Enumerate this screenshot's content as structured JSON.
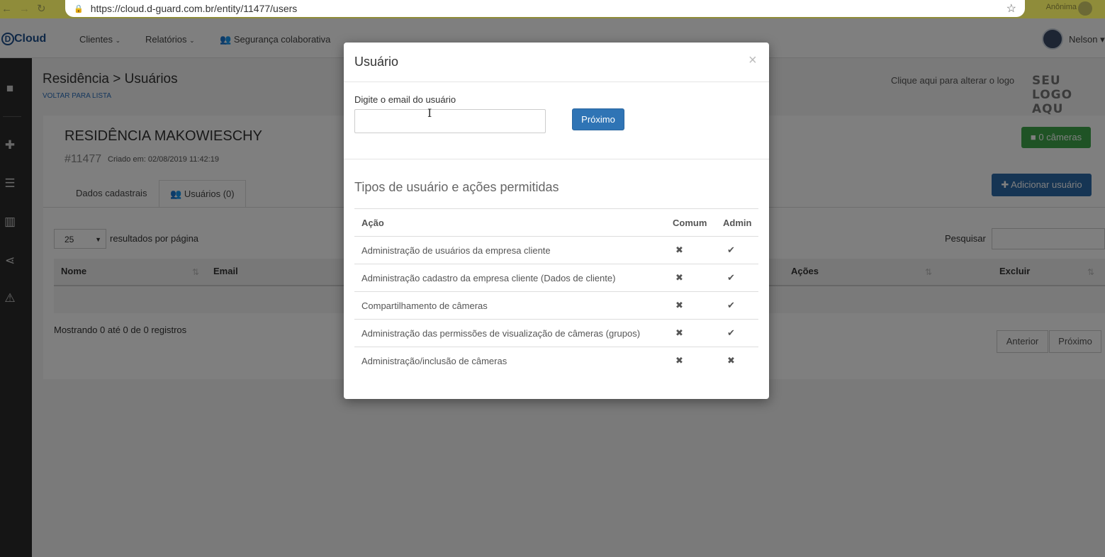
{
  "browser": {
    "url": "https://cloud.d-guard.com.br/entity/11477/users",
    "incognito_label": "Anônima"
  },
  "nav": {
    "logo": "Cloud",
    "logo_letter": "D",
    "clients": "Clientes",
    "reports": "Relatórios",
    "collab_security": "Segurança colaborativa",
    "user_name": "Nelson"
  },
  "page": {
    "breadcrumb": "Residência > Usuários",
    "back_link": "VOLTAR PARA LISTA",
    "logo_hint": "Clique aqui para alterar o logo",
    "logo_placeholder": "SEU LOGO AQU",
    "entity_title": "RESIDÊNCIA MAKOWIESCHY",
    "entity_id": "#11477",
    "entity_created": "Criado em: 02/08/2019 11:42:19",
    "cameras_button": "0 câmeras",
    "add_user_button": "Adicionar usuário",
    "tabs": {
      "registration": "Dados cadastrais",
      "users": "Usuários (0)"
    },
    "per_page_value": "25",
    "per_page_label": "resultados por página",
    "search_label": "Pesquisar",
    "columns": {
      "name": "Nome",
      "email": "Email",
      "actions": "Ações",
      "delete": "Excluir"
    },
    "showing": "Mostrando 0 até 0 de 0 registros",
    "prev": "Anterior",
    "next": "Próximo"
  },
  "modal": {
    "title": "Usuário",
    "close": "×",
    "email_label": "Digite o email do usuário",
    "email_value": "",
    "next_button": "Próximo",
    "types_heading": "Tipos de usuário e ações permitidas",
    "table_headers": {
      "action": "Ação",
      "common": "Comum",
      "admin": "Admin"
    },
    "rows": [
      {
        "action": "Administração de usuários da empresa cliente",
        "common": "✖",
        "admin": "✔"
      },
      {
        "action": "Administração cadastro da empresa cliente (Dados de cliente)",
        "common": "✖",
        "admin": "✔"
      },
      {
        "action": "Compartilhamento de câmeras",
        "common": "✖",
        "admin": "✔"
      },
      {
        "action": "Administração das permissões de visualização de câmeras (grupos)",
        "common": "✖",
        "admin": "✔"
      },
      {
        "action": "Administração/inclusão de câmeras",
        "common": "✖",
        "admin": "✖"
      }
    ]
  },
  "colors": {
    "primary": "#2f74b5",
    "success": "#3ea64b",
    "sidebar": "#2b2b2b"
  }
}
